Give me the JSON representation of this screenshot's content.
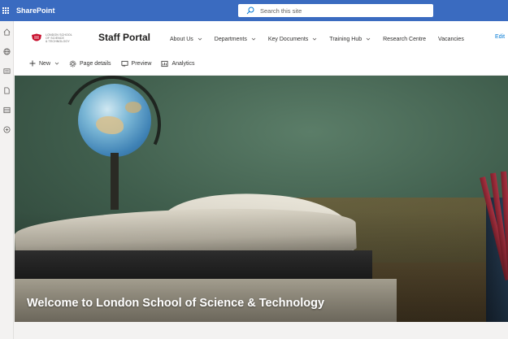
{
  "suite": {
    "app_name": "SharePoint",
    "search_placeholder": "Search this site"
  },
  "site": {
    "logo_lines": [
      "LONDON SCHOOL",
      "OF SCIENCE",
      "& TECHNOLOGY"
    ],
    "title": "Staff Portal"
  },
  "nav": {
    "items": [
      {
        "label": "About Us",
        "has_dropdown": true
      },
      {
        "label": "Departments",
        "has_dropdown": true
      },
      {
        "label": "Key Documents",
        "has_dropdown": true
      },
      {
        "label": "Training Hub",
        "has_dropdown": true
      },
      {
        "label": "Research Centre",
        "has_dropdown": false
      },
      {
        "label": "Vacancies",
        "has_dropdown": false
      }
    ],
    "edit_label": "Edit"
  },
  "commands": {
    "new_label": "New",
    "page_details_label": "Page details",
    "preview_label": "Preview",
    "analytics_label": "Analytics"
  },
  "hero": {
    "title": "Welcome to London School of Science & Technology"
  },
  "rail": {
    "icons": [
      "home-icon",
      "globe-icon",
      "news-icon",
      "document-icon",
      "list-icon",
      "add-circle-icon"
    ]
  },
  "colors": {
    "suite_bar": "#3a6bc0",
    "link": "#0078d4"
  }
}
